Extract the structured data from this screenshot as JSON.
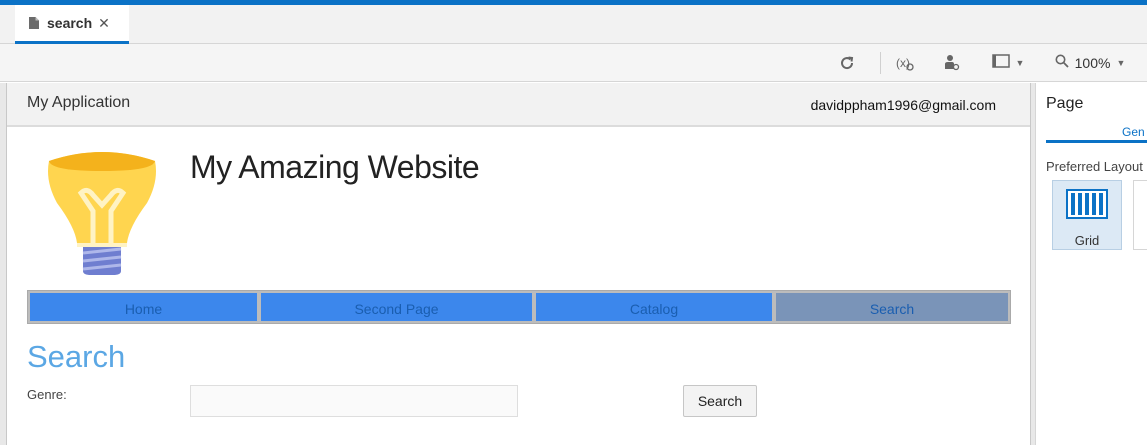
{
  "tab": {
    "label": "search",
    "close": "✕"
  },
  "toolbar": {
    "zoom": "100%"
  },
  "app": {
    "title": "My Application",
    "user_email": "davidppham1996@gmail.com"
  },
  "site": {
    "title": "My Amazing Website"
  },
  "nav": {
    "items": [
      {
        "label": "Home"
      },
      {
        "label": "Second Page"
      },
      {
        "label": "Catalog"
      },
      {
        "label": "Search"
      }
    ]
  },
  "page": {
    "heading": "Search",
    "genre_label": "Genre:",
    "genre_value": "",
    "search_button": "Search"
  },
  "panel": {
    "title": "Page",
    "tab": "Gen",
    "preferred_layout": "Preferred Layout",
    "layout_option": "Grid"
  },
  "colors": {
    "accent": "#0b72c6",
    "nav_blue": "#3c87ec",
    "nav_active": "#7a94b8",
    "heading": "#5ba7e4"
  }
}
